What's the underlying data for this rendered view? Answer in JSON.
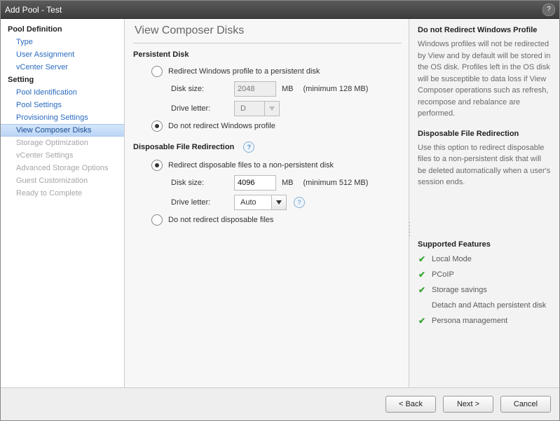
{
  "window_title": "Add Pool - Test",
  "sidebar": {
    "sections": [
      {
        "heading": "Pool Definition",
        "items": [
          {
            "label": "Type",
            "state": "link"
          },
          {
            "label": "User Assignment",
            "state": "link"
          },
          {
            "label": "vCenter Server",
            "state": "link"
          }
        ]
      },
      {
        "heading": "Setting",
        "items": [
          {
            "label": "Pool Identification",
            "state": "link"
          },
          {
            "label": "Pool Settings",
            "state": "link"
          },
          {
            "label": "Provisioning Settings",
            "state": "link"
          },
          {
            "label": "View Composer Disks",
            "state": "active"
          },
          {
            "label": "Storage Optimization",
            "state": "disabled"
          },
          {
            "label": "vCenter Settings",
            "state": "disabled"
          },
          {
            "label": "Advanced Storage Options",
            "state": "disabled"
          },
          {
            "label": "Guest Customization",
            "state": "disabled"
          },
          {
            "label": "Ready to Complete",
            "state": "disabled"
          }
        ]
      }
    ]
  },
  "page": {
    "title": "View Composer Disks",
    "persistent": {
      "title": "Persistent Disk",
      "opt_redirect": "Redirect Windows profile to a persistent disk",
      "opt_no_redirect": "Do not redirect Windows profile",
      "selected": "no_redirect",
      "disk_size_label": "Disk size:",
      "disk_size_value": "2048",
      "unit": "MB",
      "disk_size_hint": "(minimum 128 MB)",
      "drive_letter_label": "Drive letter:",
      "drive_letter_value": "D"
    },
    "disposable": {
      "title": "Disposable File Redirection",
      "opt_redirect": "Redirect disposable files to a non-persistent disk",
      "opt_no_redirect": "Do not redirect disposable files",
      "selected": "redirect",
      "disk_size_label": "Disk size:",
      "disk_size_value": "4096",
      "unit": "MB",
      "disk_size_hint": "(minimum 512 MB)",
      "drive_letter_label": "Drive letter:",
      "drive_letter_value": "Auto"
    }
  },
  "help": {
    "h1": "Do not Redirect Windows Profile",
    "p1": "Windows profiles will not be redirected by View and by default will be stored in the OS disk. Profiles left in the OS disk will be susceptible to data loss if View Composer operations such as refresh, recompose and rebalance are performed.",
    "h2": "Disposable File Redirection",
    "p2": "Use this option to redirect disposable files to a non-persistent disk that will be deleted automatically when a user's session ends.",
    "h3": "Supported Features",
    "features": [
      {
        "check": true,
        "label": "Local Mode"
      },
      {
        "check": true,
        "label": "PCoIP"
      },
      {
        "check": true,
        "label": "Storage savings"
      },
      {
        "check": false,
        "label": "Detach and Attach persistent disk"
      },
      {
        "check": true,
        "label": "Persona management"
      }
    ]
  },
  "footer": {
    "back": "< Back",
    "next": "Next >",
    "cancel": "Cancel"
  }
}
